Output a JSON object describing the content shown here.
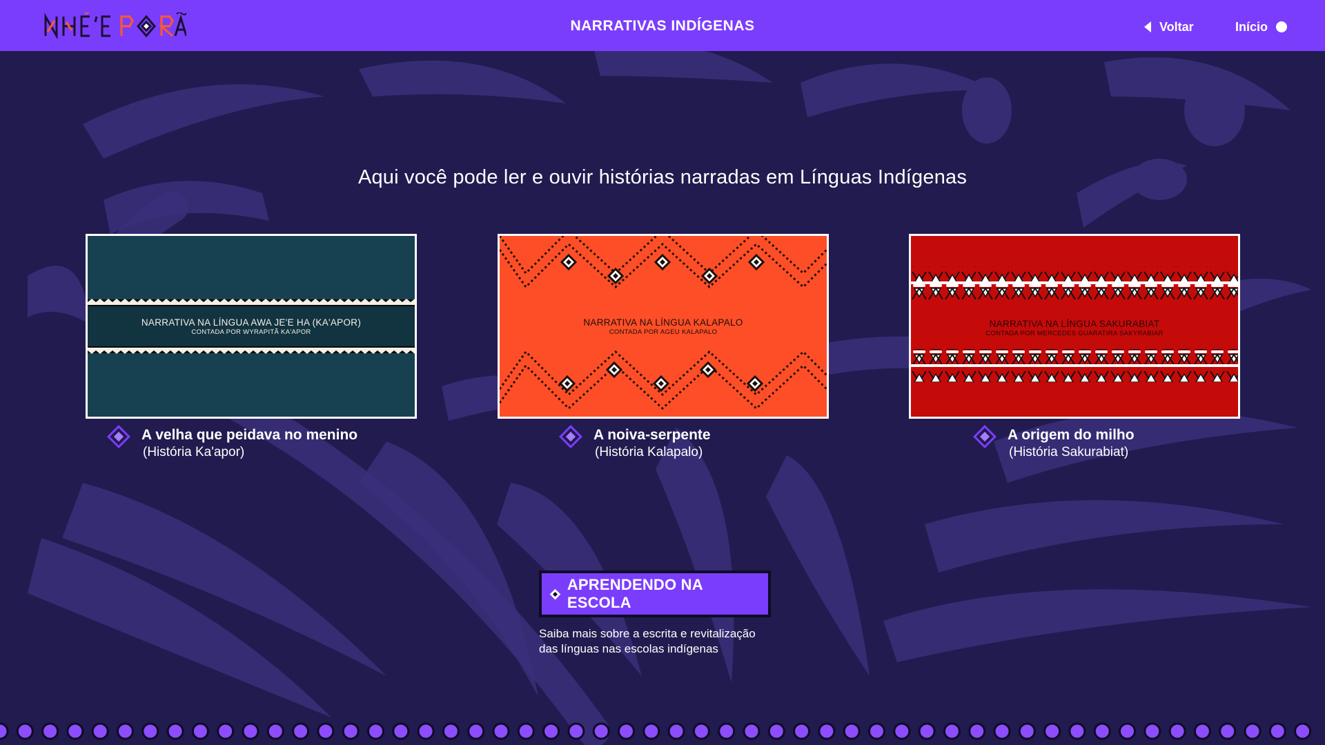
{
  "header": {
    "logo_text": "NHE'E PORÃ",
    "title": "NARRATIVAS INDÍGENAS",
    "back_label": "Voltar",
    "home_label": "Início"
  },
  "intro": "Aqui você pode ler e ouvir histórias narradas em Línguas Indígenas",
  "cards": [
    {
      "thumb_title": "NARRATIVA NA LÍNGUA AWA JE'E HA (KA'APOR)",
      "thumb_sub": "CONTADA POR WYRAPITÃ KA'APOR",
      "title": "A velha que peidava no menino",
      "subtitle": "(História Ka'apor)",
      "bg_color": "#174150"
    },
    {
      "thumb_title": "NARRATIVA NA LÍNGUA KALAPALO",
      "thumb_sub": "CONTADA POR AGEU KALAPALO",
      "title": "A noiva-serpente",
      "subtitle": "(História Kalapalo)",
      "bg_color": "#fe4e27"
    },
    {
      "thumb_title": "NARRATIVA NA LÍNGUA SAKURABIAT",
      "thumb_sub": "CONTADA POR MERCEDES GUARATIRA SAKYRABIAR",
      "title": "A origem do milho",
      "subtitle": "(História Sakurabiat)",
      "bg_color": "#c50a0a"
    }
  ],
  "cta": {
    "label": "APRENDENDO NA ESCOLA",
    "description_line1": "Saiba mais sobre a escrita e revitalização",
    "description_line2": "das línguas nas escolas indígenas"
  },
  "colors": {
    "background": "#221b4f",
    "accent": "#7b3dfc",
    "dot": "#8c4dff"
  }
}
